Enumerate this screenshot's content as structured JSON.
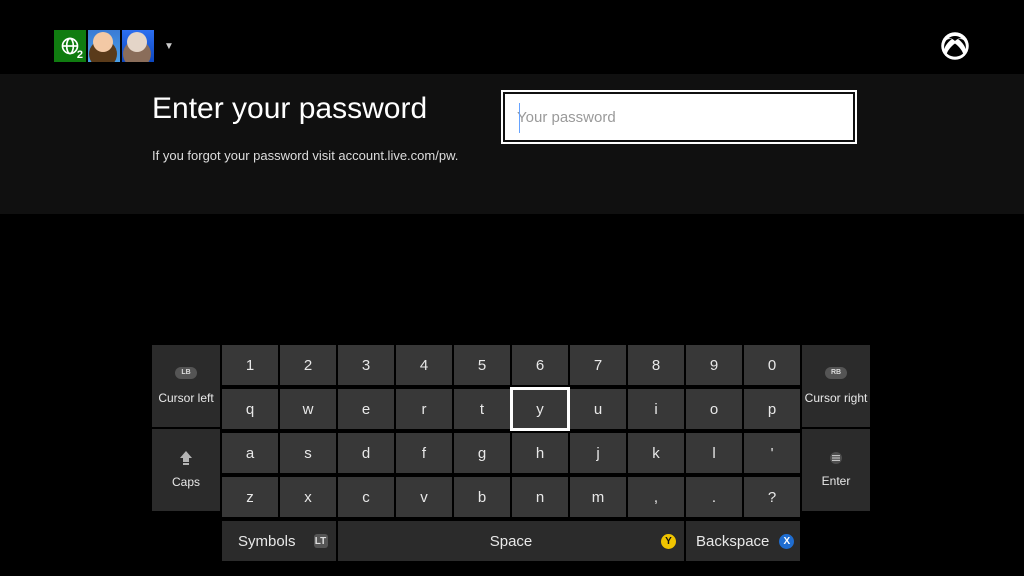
{
  "topbar": {
    "badge_count": "2",
    "logo_name": "xbox-logo"
  },
  "content": {
    "heading": "Enter your password",
    "subtext": "If you forgot your password visit account.live.com/pw.",
    "password_value": "",
    "password_placeholder": "Your password"
  },
  "keyboard": {
    "cursor_left_label": "Cursor left",
    "cursor_right_label": "Cursor right",
    "caps_label": "Caps",
    "symbols_label": "Symbols",
    "space_label": "Space",
    "backspace_label": "Backspace",
    "enter_label": "Enter",
    "lb_label": "LB",
    "rb_label": "RB",
    "lt_label": "LT",
    "y_label": "Y",
    "x_label": "X",
    "rows": {
      "r0": [
        "1",
        "2",
        "3",
        "4",
        "5",
        "6",
        "7",
        "8",
        "9",
        "0"
      ],
      "r1": [
        "q",
        "w",
        "e",
        "r",
        "t",
        "y",
        "u",
        "i",
        "o",
        "p"
      ],
      "r2": [
        "a",
        "s",
        "d",
        "f",
        "g",
        "h",
        "j",
        "k",
        "l",
        "'"
      ],
      "r3": [
        "z",
        "x",
        "c",
        "v",
        "b",
        "n",
        "m",
        ",",
        ".",
        "?"
      ]
    },
    "highlighted_key": "y"
  }
}
